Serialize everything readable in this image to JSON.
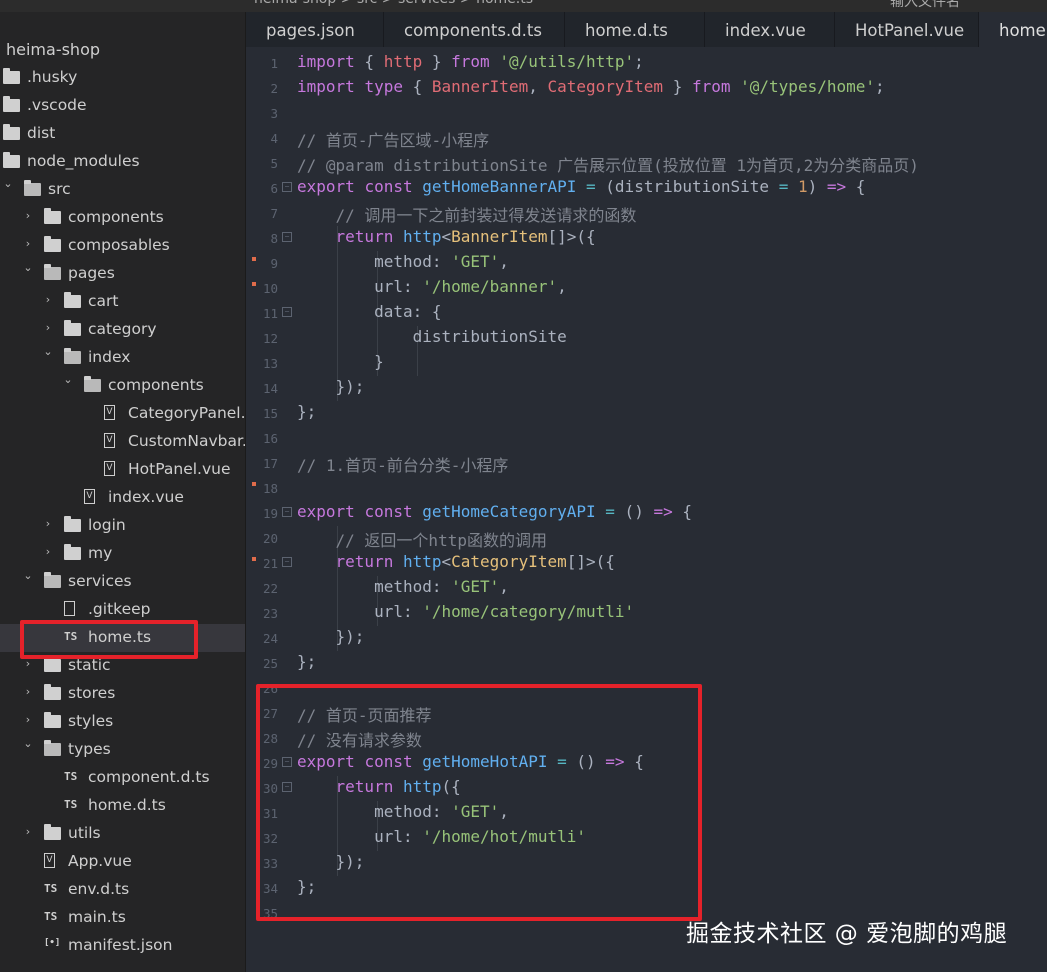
{
  "window": {
    "breadcrumb": [
      "heima-shop",
      "src",
      "services",
      "home.ts"
    ],
    "search_placeholder": "输入文件名"
  },
  "sidebar": {
    "project": "heima-shop",
    "items": [
      {
        "label": ".husky",
        "type": "folder",
        "depth": 0,
        "expanded": false,
        "chevron": false
      },
      {
        "label": ".vscode",
        "type": "folder",
        "depth": 0,
        "expanded": false,
        "chevron": false
      },
      {
        "label": "dist",
        "type": "folder",
        "depth": 0,
        "expanded": false,
        "chevron": false
      },
      {
        "label": "node_modules",
        "type": "folder",
        "depth": 0,
        "expanded": false,
        "chevron": false
      },
      {
        "label": "src",
        "type": "folder",
        "depth": 0,
        "expanded": true,
        "chevron": true
      },
      {
        "label": "components",
        "type": "folder",
        "depth": 1,
        "expanded": false,
        "chevron": true
      },
      {
        "label": "composables",
        "type": "folder",
        "depth": 1,
        "expanded": false,
        "chevron": true
      },
      {
        "label": "pages",
        "type": "folder",
        "depth": 1,
        "expanded": true,
        "chevron": true
      },
      {
        "label": "cart",
        "type": "folder",
        "depth": 2,
        "expanded": false,
        "chevron": true
      },
      {
        "label": "category",
        "type": "folder",
        "depth": 2,
        "expanded": false,
        "chevron": true
      },
      {
        "label": "index",
        "type": "folder",
        "depth": 2,
        "expanded": true,
        "chevron": true
      },
      {
        "label": "components",
        "type": "folder",
        "depth": 3,
        "expanded": true,
        "chevron": true
      },
      {
        "label": "CategoryPanel...",
        "type": "vue",
        "depth": 4
      },
      {
        "label": "CustomNavbar...",
        "type": "vue",
        "depth": 4
      },
      {
        "label": "HotPanel.vue",
        "type": "vue",
        "depth": 4
      },
      {
        "label": "index.vue",
        "type": "vue",
        "depth": 3
      },
      {
        "label": "login",
        "type": "folder",
        "depth": 2,
        "expanded": false,
        "chevron": true
      },
      {
        "label": "my",
        "type": "folder",
        "depth": 2,
        "expanded": false,
        "chevron": true
      },
      {
        "label": "services",
        "type": "folder",
        "depth": 1,
        "expanded": true,
        "chevron": true
      },
      {
        "label": ".gitkeep",
        "type": "doc",
        "depth": 2
      },
      {
        "label": "home.ts",
        "type": "ts",
        "depth": 2,
        "selected": true
      },
      {
        "label": "static",
        "type": "folder",
        "depth": 1,
        "expanded": false,
        "chevron": true
      },
      {
        "label": "stores",
        "type": "folder",
        "depth": 1,
        "expanded": false,
        "chevron": true
      },
      {
        "label": "styles",
        "type": "folder",
        "depth": 1,
        "expanded": false,
        "chevron": true
      },
      {
        "label": "types",
        "type": "folder",
        "depth": 1,
        "expanded": true,
        "chevron": true
      },
      {
        "label": "component.d.ts",
        "type": "ts",
        "depth": 2
      },
      {
        "label": "home.d.ts",
        "type": "ts",
        "depth": 2
      },
      {
        "label": "utils",
        "type": "folder",
        "depth": 1,
        "expanded": false,
        "chevron": true
      },
      {
        "label": "App.vue",
        "type": "vue",
        "depth": 1
      },
      {
        "label": "env.d.ts",
        "type": "ts",
        "depth": 1
      },
      {
        "label": "main.ts",
        "type": "ts",
        "depth": 1
      },
      {
        "label": "manifest.json",
        "type": "json",
        "depth": 1
      }
    ]
  },
  "tabs": [
    {
      "label": "pages.json",
      "active": false
    },
    {
      "label": "components.d.ts",
      "active": false
    },
    {
      "label": "home.d.ts",
      "active": false
    },
    {
      "label": "index.vue",
      "active": false
    },
    {
      "label": "HotPanel.vue",
      "active": false
    },
    {
      "label": "home.ts",
      "active": true
    }
  ],
  "editor": {
    "lines": [
      {
        "n": "1",
        "tokens": [
          [
            "kw",
            "import"
          ],
          [
            "p",
            " { "
          ],
          [
            "var",
            "http"
          ],
          [
            "p",
            " } "
          ],
          [
            "kw",
            "from"
          ],
          [
            "p",
            " "
          ],
          [
            "str",
            "'@/utils/http'"
          ],
          [
            "p",
            ";"
          ]
        ]
      },
      {
        "n": "2",
        "tokens": [
          [
            "kw",
            "import"
          ],
          [
            "p",
            " "
          ],
          [
            "kw",
            "type"
          ],
          [
            "p",
            " { "
          ],
          [
            "var",
            "BannerItem"
          ],
          [
            "p",
            ", "
          ],
          [
            "var",
            "CategoryItem"
          ],
          [
            "p",
            " } "
          ],
          [
            "kw",
            "from"
          ],
          [
            "p",
            " "
          ],
          [
            "str",
            "'@/types/home'"
          ],
          [
            "p",
            ";"
          ]
        ]
      },
      {
        "n": "3",
        "tokens": []
      },
      {
        "n": "4",
        "tokens": [
          [
            "cm",
            "// 首页-广告区域-小程序"
          ]
        ]
      },
      {
        "n": "5",
        "tokens": [
          [
            "cm",
            "// @param distributionSite 广告展示位置(投放位置 1为首页,2为分类商品页)"
          ]
        ]
      },
      {
        "n": "6",
        "fold": true,
        "tokens": [
          [
            "kw",
            "export"
          ],
          [
            "p",
            " "
          ],
          [
            "kw",
            "const"
          ],
          [
            "p",
            " "
          ],
          [
            "fn",
            "getHomeBannerAPI"
          ],
          [
            "p",
            " "
          ],
          [
            "op",
            "="
          ],
          [
            "p",
            " (distributionSite "
          ],
          [
            "op",
            "="
          ],
          [
            "p",
            " "
          ],
          [
            "num",
            "1"
          ],
          [
            "p",
            ") "
          ],
          [
            "kw",
            "=>"
          ],
          [
            "p",
            " {"
          ]
        ]
      },
      {
        "n": "7",
        "tokens": [
          [
            "p",
            "    "
          ],
          [
            "cm",
            "// 调用一下之前封装过得发送请求的函数"
          ]
        ]
      },
      {
        "n": "8",
        "fold": true,
        "tokens": [
          [
            "p",
            "    "
          ],
          [
            "kw",
            "return"
          ],
          [
            "p",
            " "
          ],
          [
            "fn",
            "http"
          ],
          [
            "p",
            "<"
          ],
          [
            "ty",
            "BannerItem"
          ],
          [
            "p",
            "[]>({"
          ]
        ]
      },
      {
        "n": "9",
        "marker": true,
        "tokens": [
          [
            "p",
            "        method: "
          ],
          [
            "str",
            "'GET'"
          ],
          [
            "p",
            ","
          ]
        ]
      },
      {
        "n": "10",
        "marker": true,
        "tokens": [
          [
            "p",
            "        url: "
          ],
          [
            "str",
            "'/home/banner'"
          ],
          [
            "p",
            ","
          ]
        ]
      },
      {
        "n": "11",
        "fold": true,
        "tokens": [
          [
            "p",
            "        data: {"
          ]
        ]
      },
      {
        "n": "12",
        "tokens": [
          [
            "p",
            "            distributionSite"
          ]
        ]
      },
      {
        "n": "13",
        "tokens": [
          [
            "p",
            "        }"
          ]
        ]
      },
      {
        "n": "14",
        "tokens": [
          [
            "p",
            "    });"
          ]
        ]
      },
      {
        "n": "15",
        "tokens": [
          [
            "p",
            "};"
          ]
        ]
      },
      {
        "n": "16",
        "tokens": []
      },
      {
        "n": "17",
        "tokens": [
          [
            "cm",
            "// 1.首页-前台分类-小程序"
          ]
        ]
      },
      {
        "n": "18",
        "marker": true,
        "tokens": []
      },
      {
        "n": "19",
        "fold": true,
        "tokens": [
          [
            "kw",
            "export"
          ],
          [
            "p",
            " "
          ],
          [
            "kw",
            "const"
          ],
          [
            "p",
            " "
          ],
          [
            "fn",
            "getHomeCategoryAPI"
          ],
          [
            "p",
            " "
          ],
          [
            "op",
            "="
          ],
          [
            "p",
            " () "
          ],
          [
            "kw",
            "=>"
          ],
          [
            "p",
            " {"
          ]
        ]
      },
      {
        "n": "20",
        "tokens": [
          [
            "p",
            "    "
          ],
          [
            "cm",
            "// 返回一个http函数的调用"
          ]
        ]
      },
      {
        "n": "21",
        "marker": true,
        "fold": true,
        "tokens": [
          [
            "p",
            "    "
          ],
          [
            "kw",
            "return"
          ],
          [
            "p",
            " "
          ],
          [
            "fn",
            "http"
          ],
          [
            "p",
            "<"
          ],
          [
            "ty",
            "CategoryItem"
          ],
          [
            "p",
            "[]>({"
          ]
        ]
      },
      {
        "n": "22",
        "tokens": [
          [
            "p",
            "        method: "
          ],
          [
            "str",
            "'GET'"
          ],
          [
            "p",
            ","
          ]
        ]
      },
      {
        "n": "23",
        "tokens": [
          [
            "p",
            "        url: "
          ],
          [
            "str",
            "'/home/category/mutli'"
          ]
        ]
      },
      {
        "n": "24",
        "tokens": [
          [
            "p",
            "    });"
          ]
        ]
      },
      {
        "n": "25",
        "tokens": [
          [
            "p",
            "};"
          ]
        ]
      },
      {
        "n": "26",
        "tokens": []
      },
      {
        "n": "27",
        "tokens": [
          [
            "cm",
            "// 首页-页面推荐"
          ]
        ]
      },
      {
        "n": "28",
        "tokens": [
          [
            "cm",
            "// 没有请求参数"
          ]
        ]
      },
      {
        "n": "29",
        "fold": true,
        "tokens": [
          [
            "kw",
            "export"
          ],
          [
            "p",
            " "
          ],
          [
            "kw",
            "const"
          ],
          [
            "p",
            " "
          ],
          [
            "fn",
            "getHomeHotAPI"
          ],
          [
            "p",
            " "
          ],
          [
            "op",
            "="
          ],
          [
            "p",
            " () "
          ],
          [
            "kw",
            "=>"
          ],
          [
            "p",
            " {"
          ]
        ]
      },
      {
        "n": "30",
        "fold": true,
        "tokens": [
          [
            "p",
            "    "
          ],
          [
            "kw",
            "return"
          ],
          [
            "p",
            " "
          ],
          [
            "fn",
            "http"
          ],
          [
            "p",
            "({"
          ]
        ]
      },
      {
        "n": "31",
        "tokens": [
          [
            "p",
            "        method: "
          ],
          [
            "str",
            "'GET'"
          ],
          [
            "p",
            ","
          ]
        ]
      },
      {
        "n": "32",
        "tokens": [
          [
            "p",
            "        url: "
          ],
          [
            "str",
            "'/home/hot/mutli'"
          ]
        ]
      },
      {
        "n": "33",
        "tokens": [
          [
            "p",
            "    });"
          ]
        ]
      },
      {
        "n": "34",
        "tokens": [
          [
            "p",
            "};"
          ]
        ]
      },
      {
        "n": "35",
        "tokens": []
      }
    ]
  },
  "watermark": "掘金技术社区 @ 爱泡脚的鸡腿",
  "colors": {
    "highlight": "#e5222a",
    "keyword": "#c678dd",
    "string": "#98c379",
    "function": "#61afef",
    "type": "#e5c07b",
    "comment": "#7f848e"
  }
}
